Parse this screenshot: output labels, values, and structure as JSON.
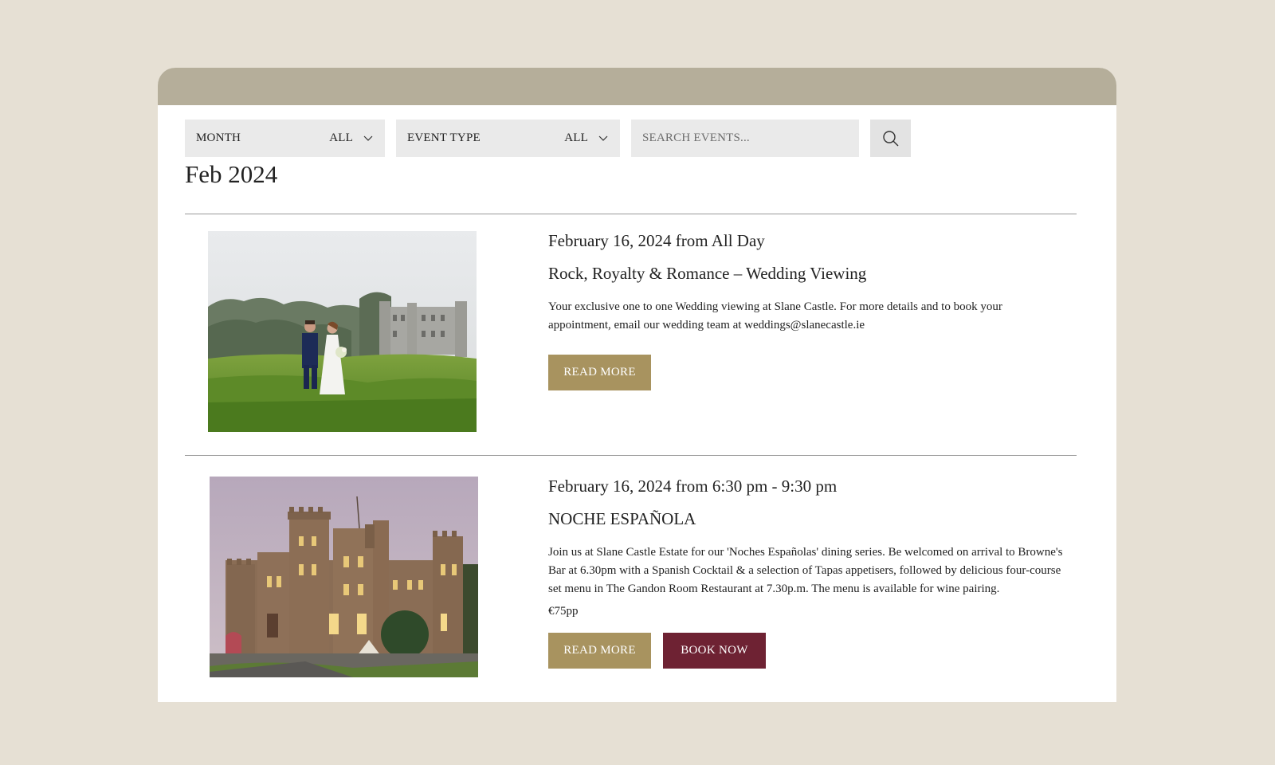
{
  "filters": {
    "month_label": "MONTH",
    "month_value": "ALL",
    "type_label": "EVENT TYPE",
    "type_value": "ALL",
    "search_placeholder": "SEARCH EVENTS..."
  },
  "month_heading": "Feb 2024",
  "events": [
    {
      "date": "February 16, 2024 from All Day",
      "title": "Rock, Royalty & Romance – Wedding Viewing",
      "description": "Your exclusive one to one Wedding viewing at Slane Castle. For more details and to book your appointment, email our wedding team at weddings@slanecastle.ie",
      "read_more": "READ MORE",
      "image": "wedding-couple-castle-photo"
    },
    {
      "date": "February 16, 2024 from 6:30 pm - 9:30 pm",
      "title": "NOCHE ESPAÑOLA",
      "description": "Join us at Slane Castle Estate for our 'Noches Españolas' dining series. Be welcomed on arrival to Browne's Bar at 6.30pm with a Spanish Cocktail & a selection of Tapas appetisers, followed by delicious four-course set menu in The Gandon Room Restaurant at 7.30p.m. The menu is available for wine pairing.",
      "price": "€75pp",
      "read_more": "READ MORE",
      "book_now": "BOOK NOW",
      "image": "castle-evening-photo"
    }
  ],
  "colors": {
    "background": "#e6e0d4",
    "header_band": "#b5ae9a",
    "read_more": "#a8935f",
    "book_now": "#6e2233"
  }
}
